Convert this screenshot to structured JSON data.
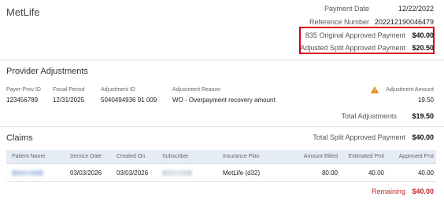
{
  "header": {
    "payer_name": "MetLife",
    "payment_date_label": "Payment Date",
    "payment_date": "12/22/2022",
    "reference_number_label": "Reference Number",
    "reference_number": "202212190046479",
    "original_approved_label": "835 Original Approved Payment",
    "original_approved_value": "$40.00",
    "adjusted_split_label": "Adjusted Split Approved Payment",
    "adjusted_split_value": "$20.50"
  },
  "provider_adjustments": {
    "title": "Provider Adjustments",
    "columns": {
      "payer_prov_id": "Payer-Prov ID",
      "fiscal_period": "Fiscal Period",
      "adjustment_id": "Adjustment ID",
      "adjustment_reason": "Adjustment Reason",
      "adjustment_amount": "Adjustment Amount"
    },
    "row": {
      "payer_prov_id": "123456789",
      "fiscal_period": "12/31/2025",
      "adjustment_id": "5040494936 91 009",
      "adjustment_reason": "WO - Overpayment recovery amount",
      "adjustment_amount": "19.50"
    },
    "total_label": "Total Adjustments",
    "total_value": "$19.50",
    "warning_color": "#e08a00"
  },
  "claims": {
    "title": "Claims",
    "total_split_label": "Total Split Approved Payment",
    "total_split_value": "$40.00",
    "columns": {
      "patient_name": "Patient Name",
      "service_date": "Service Date",
      "created_on": "Created On",
      "subscriber": "Subscriber",
      "insurance_plan": "Insurance Plan",
      "amount_billed": "Amount Billed",
      "estimated_pmt": "Estimated Pmt",
      "approved_pmt": "Approved Pmt"
    },
    "rows": [
      {
        "service_date": "03/03/2026",
        "created_on": "03/03/2026",
        "insurance_plan": "MetLife (d32)",
        "amount_billed": "80.00",
        "estimated_pmt": "40.00",
        "approved_pmt": "40.00"
      }
    ],
    "remaining_label": "Remaining",
    "remaining_value": "$40.00"
  },
  "colors": {
    "highlight_border": "#d90016",
    "remaining": "#c62828",
    "table_header_bg": "#e6ecf5"
  }
}
